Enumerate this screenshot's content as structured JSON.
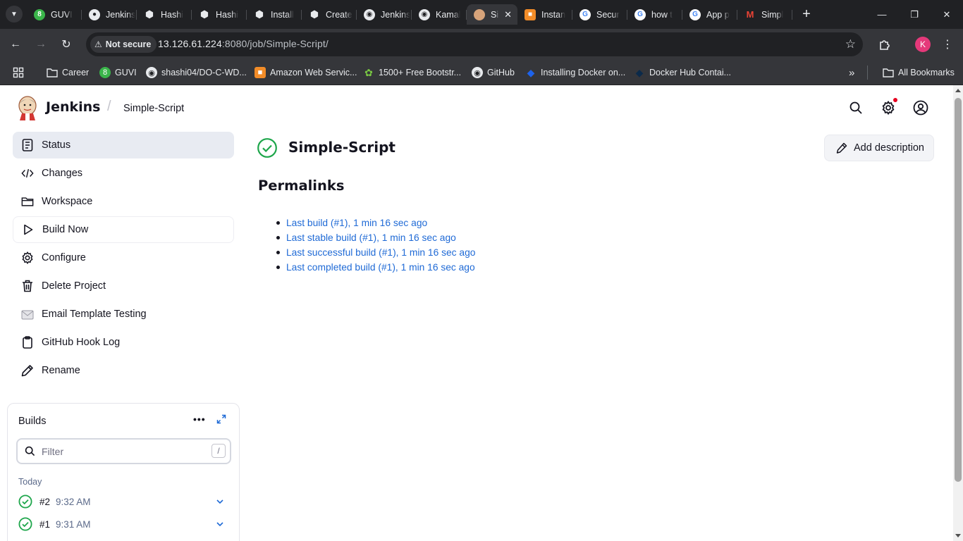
{
  "browser": {
    "tabs": [
      {
        "label": "GUVI",
        "icon": "guvi-icon",
        "color": "#3ab54a"
      },
      {
        "label": "Jenkins",
        "icon": "globe-icon",
        "color": "#e8eaed"
      },
      {
        "label": "Hashi",
        "icon": "hashicorp-icon",
        "color": "#e8eaed"
      },
      {
        "label": "Hashi",
        "icon": "hashicorp-icon",
        "color": "#e8eaed"
      },
      {
        "label": "Install",
        "icon": "hashicorp-icon",
        "color": "#e8eaed"
      },
      {
        "label": "Create",
        "icon": "hashicorp-icon",
        "color": "#e8eaed"
      },
      {
        "label": "Jenkins",
        "icon": "github-icon",
        "color": "#e8eaed"
      },
      {
        "label": "Kamal",
        "icon": "github-icon",
        "color": "#e8eaed"
      },
      {
        "label": "Si",
        "icon": "jenkins-icon",
        "color": "#d6a37a",
        "active": true
      },
      {
        "label": "Instan",
        "icon": "aws-icon",
        "color": "#f28c28"
      },
      {
        "label": "Secur",
        "icon": "google-icon",
        "color": "#4285f4"
      },
      {
        "label": "how t",
        "icon": "google-icon",
        "color": "#4285f4"
      },
      {
        "label": "App p",
        "icon": "google-icon",
        "color": "#4285f4"
      },
      {
        "label": "Simpl",
        "icon": "gmail-icon",
        "color": "#ea4335"
      }
    ],
    "not_secure_label": "Not secure",
    "url_host": "13.126.61.224",
    "url_rest": ":8080/job/Simple-Script/",
    "profile_initial": "K",
    "bookmarks": [
      {
        "label": "Career",
        "icon": "folder-icon"
      },
      {
        "label": "GUVI",
        "icon": "guvi-icon"
      },
      {
        "label": "shashi04/DO-C-WD...",
        "icon": "github-icon"
      },
      {
        "label": "Amazon Web Servic...",
        "icon": "aws-icon"
      },
      {
        "label": "1500+ Free Bootstr...",
        "icon": "leaf-icon"
      },
      {
        "label": "GitHub",
        "icon": "github-icon"
      },
      {
        "label": "Installing Docker on...",
        "icon": "docker-icon"
      },
      {
        "label": "Docker Hub Contai...",
        "icon": "docker-icon"
      }
    ],
    "all_bookmarks_label": "All Bookmarks"
  },
  "header": {
    "brand": "Jenkins",
    "breadcrumb": "Simple-Script"
  },
  "sidebar": {
    "items": [
      {
        "label": "Status",
        "icon": "document-icon"
      },
      {
        "label": "Changes",
        "icon": "code-icon"
      },
      {
        "label": "Workspace",
        "icon": "folder-icon"
      },
      {
        "label": "Build Now",
        "icon": "play-icon"
      },
      {
        "label": "Configure",
        "icon": "gear-icon"
      },
      {
        "label": "Delete Project",
        "icon": "trash-icon"
      },
      {
        "label": "Email Template Testing",
        "icon": "email-icon"
      },
      {
        "label": "GitHub Hook Log",
        "icon": "clipboard-icon"
      },
      {
        "label": "Rename",
        "icon": "pencil-icon"
      }
    ]
  },
  "builds": {
    "title": "Builds",
    "filter_placeholder": "Filter",
    "filter_shortcut": "/",
    "group_label": "Today",
    "rows": [
      {
        "number": "#2",
        "time": "9:32 AM",
        "status": "success"
      },
      {
        "number": "#1",
        "time": "9:31 AM",
        "status": "success"
      }
    ]
  },
  "main": {
    "title": "Simple-Script",
    "add_description_label": "Add description",
    "permalinks_heading": "Permalinks",
    "permalinks": [
      "Last build (#1), 1 min 16 sec ago",
      "Last stable build (#1), 1 min 16 sec ago",
      "Last successful build (#1), 1 min 16 sec ago",
      "Last completed build (#1), 1 min 16 sec ago"
    ]
  },
  "colors": {
    "success": "#1ea64b",
    "link": "#1f6ad6",
    "text": "#14141f",
    "active_bg": "#e8ebf2",
    "chrome_dark": "#202124",
    "chrome_mid": "#35363a"
  }
}
